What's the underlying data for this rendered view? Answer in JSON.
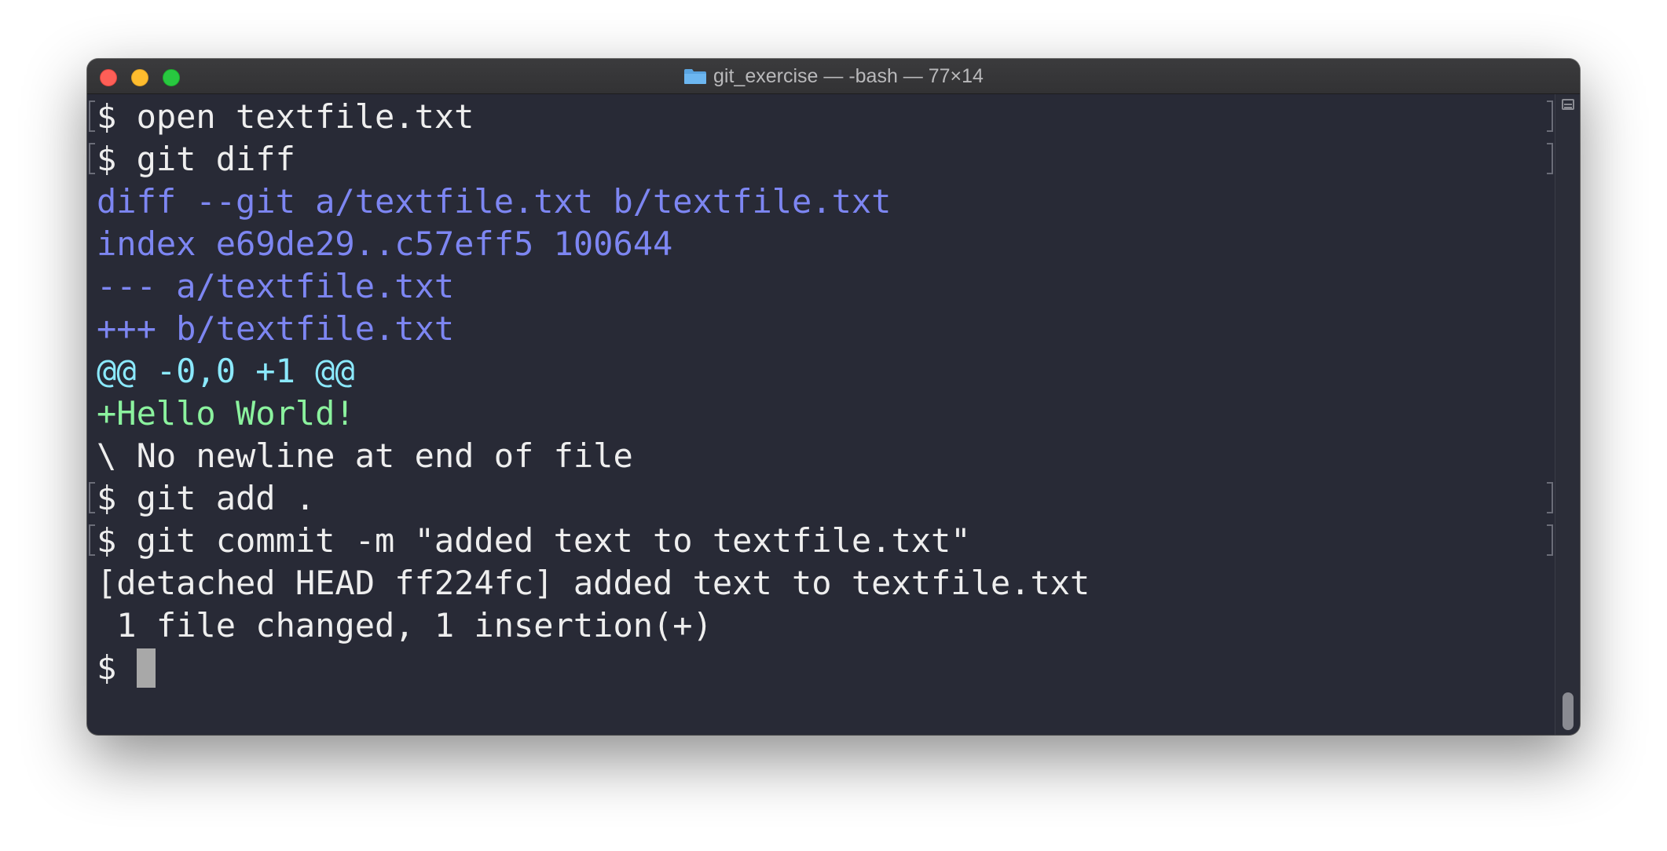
{
  "window": {
    "title": "git_exercise — -bash — 77×14",
    "folder_icon": "folder-icon",
    "controls": {
      "close": "close-button",
      "minimize": "minimize-button",
      "maximize": "maximize-button"
    }
  },
  "colors": {
    "background": "#282a36",
    "text": "#eeeeee",
    "diff_meta": "#7d86f2",
    "diff_hunk": "#8be9fd",
    "diff_add": "#8bf29e",
    "cursor": "#a8a8a8"
  },
  "terminal": {
    "lines": [
      {
        "text": "$ open textfile.txt",
        "kind": "prompt",
        "marked": true
      },
      {
        "text": "$ git diff",
        "kind": "prompt",
        "marked": true
      },
      {
        "text": "diff --git a/textfile.txt b/textfile.txt",
        "kind": "meta",
        "marked": false
      },
      {
        "text": "index e69de29..c57eff5 100644",
        "kind": "meta",
        "marked": false
      },
      {
        "text": "--- a/textfile.txt",
        "kind": "meta",
        "marked": false
      },
      {
        "text": "+++ b/textfile.txt",
        "kind": "meta",
        "marked": false
      },
      {
        "text": "@@ -0,0 +1 @@",
        "kind": "hunk",
        "marked": false
      },
      {
        "text": "+Hello World!",
        "kind": "add",
        "marked": false
      },
      {
        "text": "\\ No newline at end of file",
        "kind": "output",
        "marked": false
      },
      {
        "text": "$ git add .",
        "kind": "prompt",
        "marked": true
      },
      {
        "text": "$ git commit -m \"added text to textfile.txt\"",
        "kind": "prompt",
        "marked": true
      },
      {
        "text": "[detached HEAD ff224fc] added text to textfile.txt",
        "kind": "output",
        "marked": false
      },
      {
        "text": " 1 file changed, 1 insertion(+)",
        "kind": "output",
        "marked": false
      }
    ],
    "prompt": "$ "
  }
}
